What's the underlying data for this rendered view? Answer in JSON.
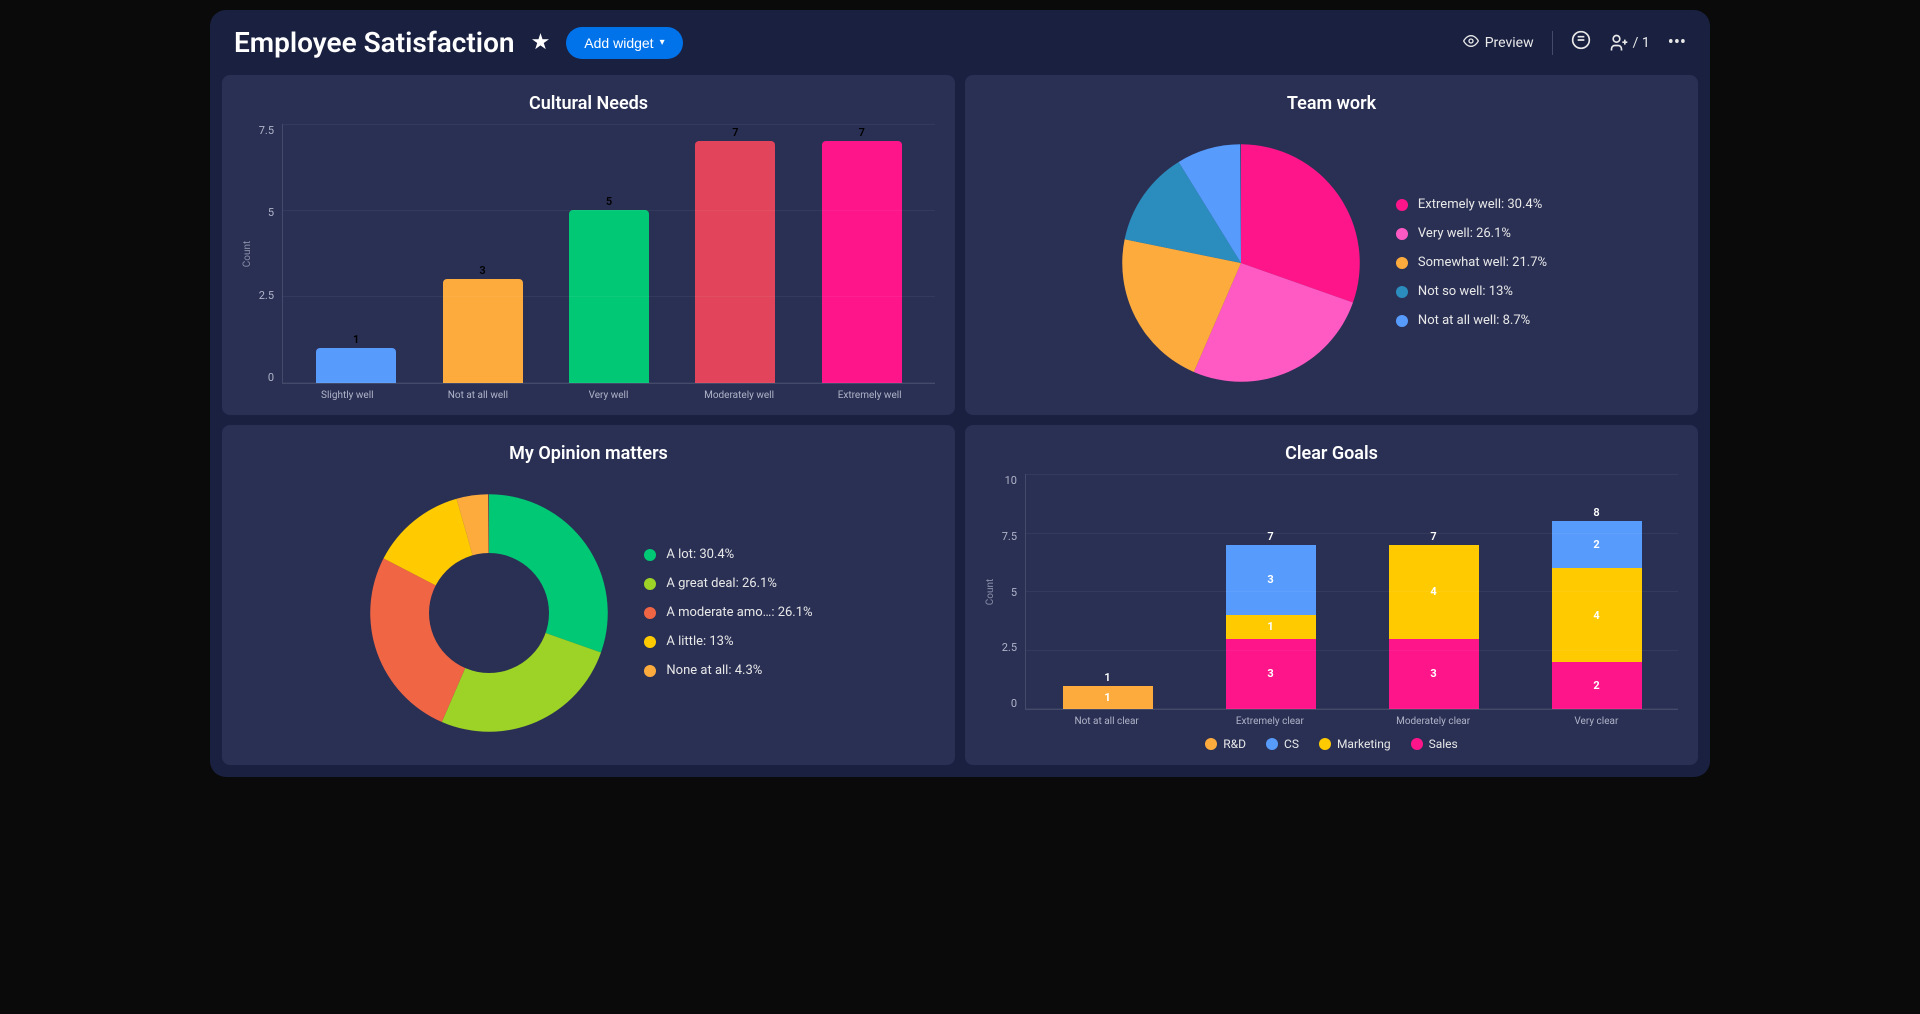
{
  "header": {
    "title": "Employee Satisfaction",
    "add_widget_label": "Add widget",
    "preview_label": "Preview",
    "share_count": "/ 1"
  },
  "panels": {
    "cultural_needs": {
      "title": "Cultural Needs",
      "ylabel": "Count"
    },
    "team_work": {
      "title": "Team work"
    },
    "opinion": {
      "title": "My Opinion matters"
    },
    "clear_goals": {
      "title": "Clear Goals",
      "ylabel": "Count"
    }
  },
  "colors": {
    "blue": "#579bfc",
    "orange": "#fdab3d",
    "green": "#00c875",
    "red": "#e2445c",
    "pink": "#ff158a",
    "hotpink": "#ff5ac4",
    "teal": "#2b8cbe",
    "lime": "#9cd326",
    "orangeRed": "#f06543",
    "yellow": "#ffcb00"
  },
  "chart_data": [
    {
      "id": "cultural_needs",
      "type": "bar",
      "title": "Cultural Needs",
      "ylabel": "Count",
      "ylim": [
        0,
        7.5
      ],
      "yticks": [
        0,
        2.5,
        5,
        7.5
      ],
      "categories": [
        "Slightly well",
        "Not at all well",
        "Very well",
        "Moderately well",
        "Extremely well"
      ],
      "values": [
        1,
        3,
        5,
        7,
        7
      ],
      "bar_colors": [
        "#579bfc",
        "#fdab3d",
        "#00c875",
        "#e2445c",
        "#ff158a"
      ]
    },
    {
      "id": "team_work",
      "type": "pie",
      "title": "Team work",
      "series": [
        {
          "name": "Extremely well",
          "value": 30.4,
          "color": "#ff158a"
        },
        {
          "name": "Very well",
          "value": 26.1,
          "color": "#ff5ac4"
        },
        {
          "name": "Somewhat well",
          "value": 21.7,
          "color": "#fdab3d"
        },
        {
          "name": "Not so well",
          "value": 13.0,
          "color": "#2b8cbe"
        },
        {
          "name": "Not at all well",
          "value": 8.7,
          "color": "#579bfc"
        }
      ]
    },
    {
      "id": "opinion",
      "type": "pie",
      "donut": true,
      "title": "My Opinion matters",
      "series": [
        {
          "name": "A lot",
          "value": 30.4,
          "color": "#00c875"
        },
        {
          "name": "A great deal",
          "value": 26.1,
          "color": "#9cd326"
        },
        {
          "name": "A moderate amo…",
          "value": 26.1,
          "color": "#f06543"
        },
        {
          "name": "A little",
          "value": 13.0,
          "color": "#ffcb00"
        },
        {
          "name": "None at all",
          "value": 4.3,
          "color": "#fdab3d"
        }
      ]
    },
    {
      "id": "clear_goals",
      "type": "bar",
      "stacked": true,
      "title": "Clear Goals",
      "ylabel": "Count",
      "ylim": [
        0,
        10
      ],
      "yticks": [
        0,
        2.5,
        5,
        7.5,
        10
      ],
      "categories": [
        "Not at all clear",
        "Extremely clear",
        "Moderately clear",
        "Very clear"
      ],
      "series": [
        {
          "name": "R&D",
          "color": "#fdab3d",
          "values": [
            1,
            0,
            0,
            0
          ]
        },
        {
          "name": "CS",
          "color": "#579bfc",
          "values": [
            0,
            3,
            0,
            2
          ]
        },
        {
          "name": "Marketing",
          "color": "#ffcb00",
          "values": [
            0,
            1,
            4,
            4
          ]
        },
        {
          "name": "Sales",
          "color": "#ff158a",
          "values": [
            0,
            3,
            3,
            2
          ]
        }
      ],
      "totals": [
        1,
        7,
        7,
        8
      ]
    }
  ]
}
